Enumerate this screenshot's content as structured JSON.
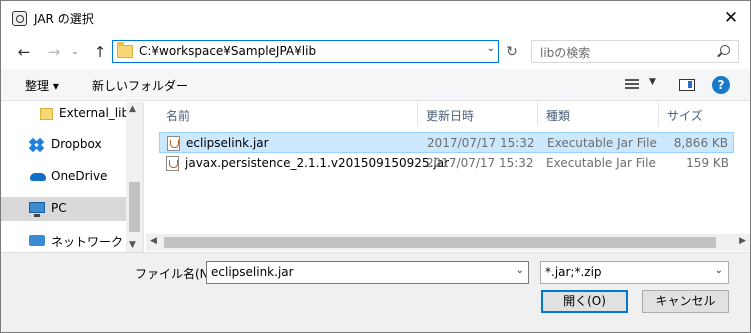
{
  "window": {
    "title": "JAR の選択",
    "close_glyph": "✕"
  },
  "address": {
    "path": "C:¥workspace¥SampleJPA¥lib",
    "search_placeholder": "libの検索"
  },
  "icons": {
    "back": "←",
    "forward": "→",
    "recent": "⌄",
    "up": "↑",
    "refresh": "↻",
    "dropdown": "⌄",
    "sort_up": "^",
    "scroll_up": "▲",
    "scroll_down": "▼",
    "scroll_left": "◀",
    "scroll_right": "▶",
    "view_drop": "▼",
    "help": "?"
  },
  "toolbar": {
    "organize": "整理 ▾",
    "new_folder": "新しいフォルダー"
  },
  "nav_pane": {
    "items": [
      {
        "label": "External_lib",
        "icon": "folder-icon"
      },
      {
        "label": "Dropbox",
        "icon": "dropbox-icon"
      },
      {
        "label": "OneDrive",
        "icon": "onedrive-icon"
      },
      {
        "label": "PC",
        "icon": "pc-icon",
        "selected": true
      },
      {
        "label": "ネットワーク",
        "icon": "network-icon"
      }
    ]
  },
  "file_list": {
    "columns": {
      "name": "名前",
      "date": "更新日時",
      "type": "種類",
      "size": "サイズ"
    },
    "rows": [
      {
        "name": "eclipselink.jar",
        "date": "2017/07/17 15:32",
        "type": "Executable Jar File",
        "size": "8,866 KB",
        "selected": true
      },
      {
        "name": "javax.persistence_2.1.1.v201509150925.jar",
        "date": "2017/07/17 15:32",
        "type": "Executable Jar File",
        "size": "159 KB",
        "selected": false
      }
    ]
  },
  "bottom": {
    "filename_label": "ファイル名(N):",
    "filename_value": "eclipselink.jar",
    "filter_value": "*.jar;*.zip",
    "open_button": "開く(O)",
    "cancel_button": "キャンセル"
  },
  "colors": {
    "accent": "#0078d7",
    "selection": "#cce8ff",
    "help": "#1979ca"
  }
}
